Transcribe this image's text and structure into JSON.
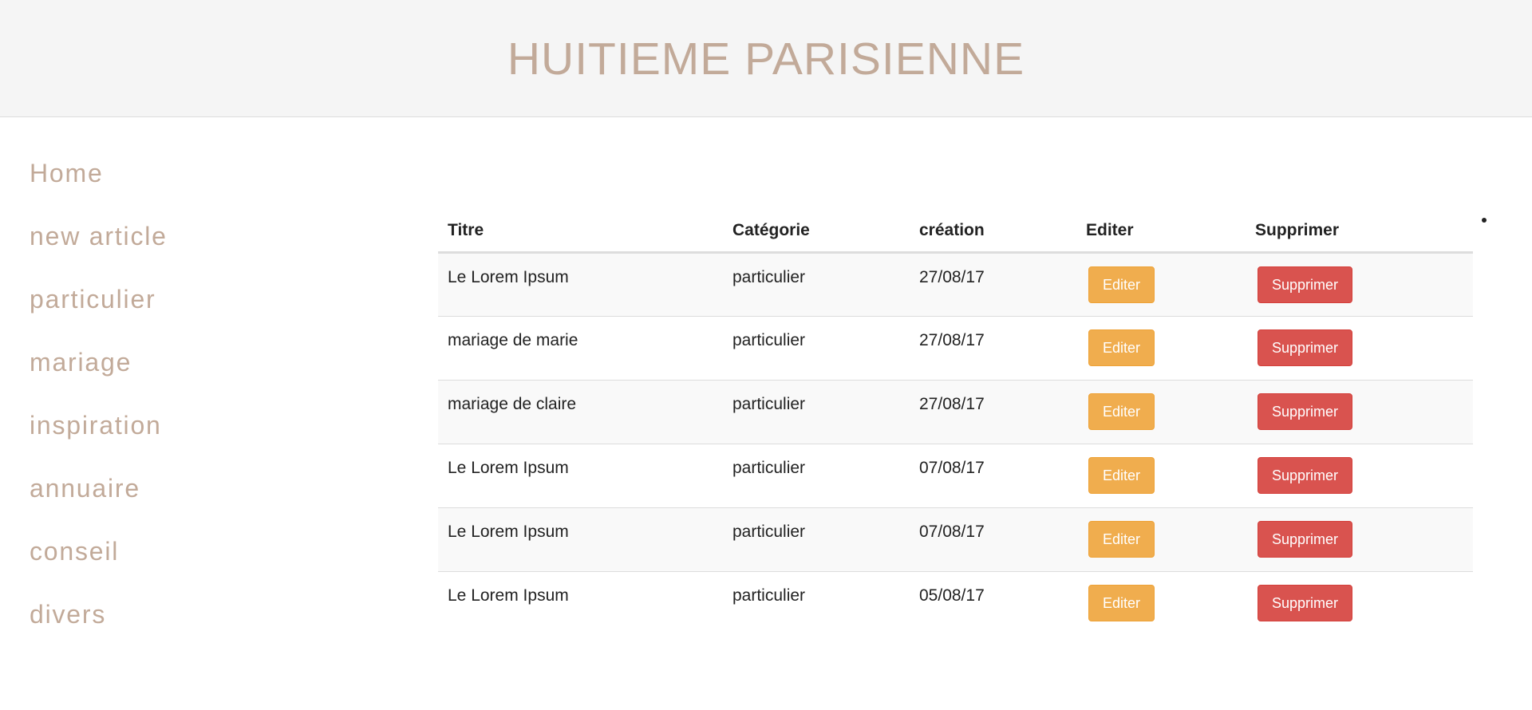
{
  "site": {
    "title": "HUITIEME PARISIENNE"
  },
  "sidebar": {
    "items": [
      {
        "label": "Home"
      },
      {
        "label": "new article"
      },
      {
        "label": "particulier"
      },
      {
        "label": "mariage"
      },
      {
        "label": "inspiration"
      },
      {
        "label": "annuaire"
      },
      {
        "label": "conseil"
      },
      {
        "label": "divers"
      }
    ]
  },
  "table": {
    "headers": {
      "titre": "Titre",
      "categorie": "Catégorie",
      "creation": "création",
      "editer": "Editer",
      "supprimer": "Supprimer"
    },
    "edit_label": "Editer",
    "delete_label": "Supprimer",
    "rows": [
      {
        "titre": "Le Lorem Ipsum",
        "categorie": "particulier",
        "creation": "27/08/17"
      },
      {
        "titre": "mariage de marie",
        "categorie": "particulier",
        "creation": "27/08/17"
      },
      {
        "titre": "mariage de claire",
        "categorie": "particulier",
        "creation": "27/08/17"
      },
      {
        "titre": "Le Lorem Ipsum",
        "categorie": "particulier",
        "creation": "07/08/17"
      },
      {
        "titre": "Le Lorem Ipsum",
        "categorie": "particulier",
        "creation": "07/08/17"
      },
      {
        "titre": "Le Lorem Ipsum",
        "categorie": "particulier",
        "creation": "05/08/17"
      }
    ]
  },
  "colors": {
    "brand": "#c2aa99",
    "header_bg": "#f5f5f5",
    "edit_button": "#f0ad4e",
    "delete_button": "#d9534f"
  }
}
